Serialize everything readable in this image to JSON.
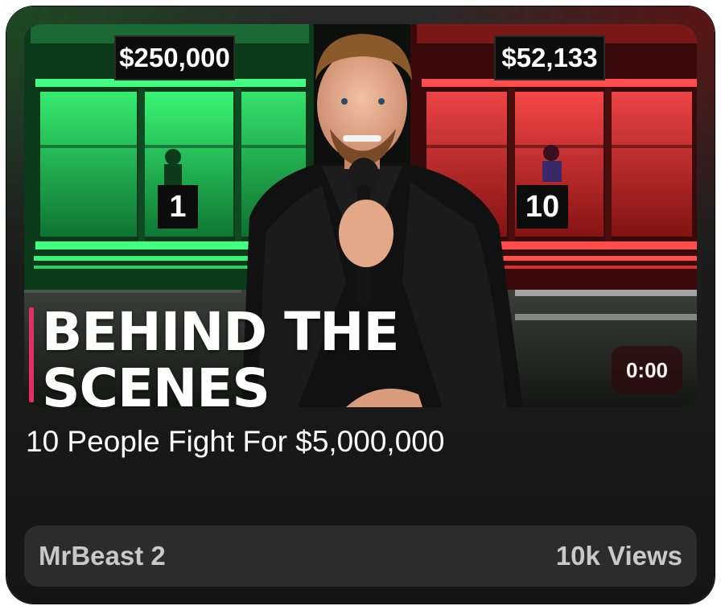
{
  "video": {
    "title": "10 People Fight For $5,000,000",
    "duration": "0:00"
  },
  "thumbnail": {
    "left_booth_prize": "$250,000",
    "right_booth_prize": "$52,133",
    "left_booth_number": "1",
    "right_booth_number": "10",
    "overlay_line1": "BEHIND THE",
    "overlay_line2": "SCENES",
    "colors": {
      "left_booth": "#22d65a",
      "right_booth": "#e52a2a",
      "accent_bar": "#e0306a"
    }
  },
  "meta": {
    "channel": "MrBeast 2",
    "views": "10k Views"
  }
}
